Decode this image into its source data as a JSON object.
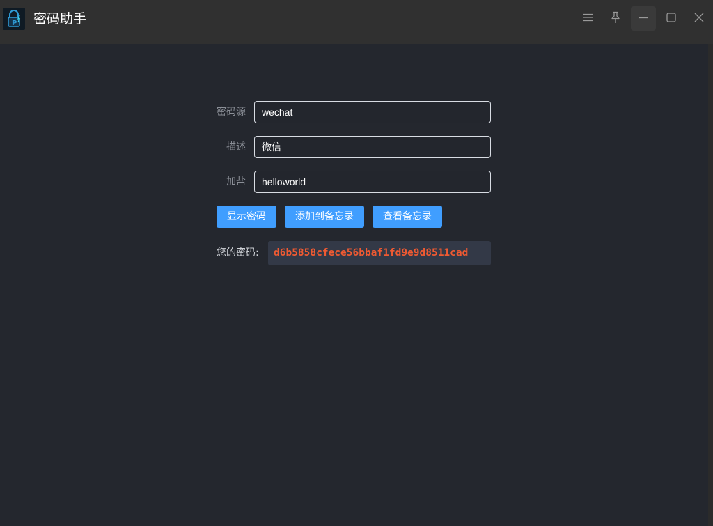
{
  "window": {
    "title": "密码助手",
    "icons": {
      "app": "lock-p-icon",
      "menu": "menu-icon",
      "pin": "pin-icon",
      "minimize": "minimize-icon",
      "maximize": "maximize-icon",
      "close": "close-icon"
    }
  },
  "form": {
    "source_label": "密码源",
    "source_value": "wechat",
    "desc_label": "描述",
    "desc_value": "微信",
    "salt_label": "加盐",
    "salt_value": "helloworld"
  },
  "buttons": {
    "show_password": "显示密码",
    "add_memo": "添加到备忘录",
    "view_memo": "查看备忘录"
  },
  "result": {
    "label": "您的密码:",
    "value": "d6b5858cfece56bbaf1fd9e9d8511cad"
  },
  "colors": {
    "accent": "#409eff",
    "password_text": "#f05a32",
    "background": "#24272e",
    "titlebar": "#303030"
  }
}
